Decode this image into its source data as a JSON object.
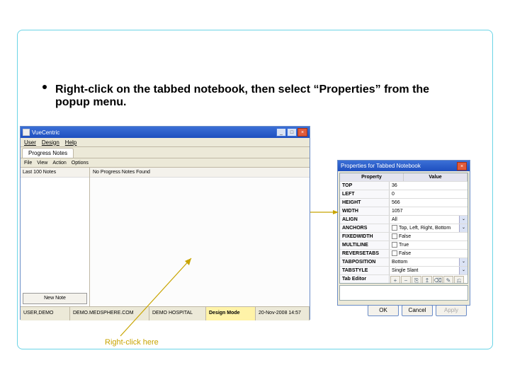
{
  "instruction": "Right-click on the tabbed notebook, then select “Properties” from the popup menu.",
  "caption": "Right-click here",
  "vc": {
    "title": "VueCentric",
    "menus": [
      "User",
      "Design",
      "Help"
    ],
    "tab": "Progress Notes",
    "toolbar2": [
      "File",
      "View",
      "Action",
      "Options"
    ],
    "sidehdr": "Last 100 Notes",
    "mainhdr": "No Progress Notes Found",
    "newnote": "New Note",
    "status": {
      "user": "USER,DEMO",
      "server": "DEMO.MEDSPHERE.COM",
      "site": "DEMO HOSPITAL",
      "mode": "Design Mode",
      "datetime": "20-Nov-2008 14:57"
    }
  },
  "pw": {
    "title": "Properties for Tabbed Notebook",
    "hdr": {
      "prop": "Property",
      "val": "Value"
    },
    "rows": [
      {
        "k": "TOP",
        "v": "36"
      },
      {
        "k": "LEFT",
        "v": "0"
      },
      {
        "k": "HEIGHT",
        "v": "566"
      },
      {
        "k": "WIDTH",
        "v": "1057"
      },
      {
        "k": "ALIGN",
        "v": "All",
        "dd": true
      },
      {
        "k": "ANCHORS",
        "v": "Top, Left, Right, Bottom",
        "cb": true,
        "dd": true
      },
      {
        "k": "FIXEDWIDTH",
        "v": "False",
        "cb": true
      },
      {
        "k": "MULTILINE",
        "v": "True",
        "cb": true
      },
      {
        "k": "REVERSETABS",
        "v": "False",
        "cb": true
      },
      {
        "k": "TABPOSITION",
        "v": "Bottom",
        "dd": true
      },
      {
        "k": "TABSTYLE",
        "v": "Single Slant",
        "dd": true
      },
      {
        "k": "Tab Editor",
        "v": "",
        "toolbar": true
      }
    ],
    "buttons": {
      "ok": "OK",
      "cancel": "Cancel",
      "apply": "Apply"
    }
  }
}
